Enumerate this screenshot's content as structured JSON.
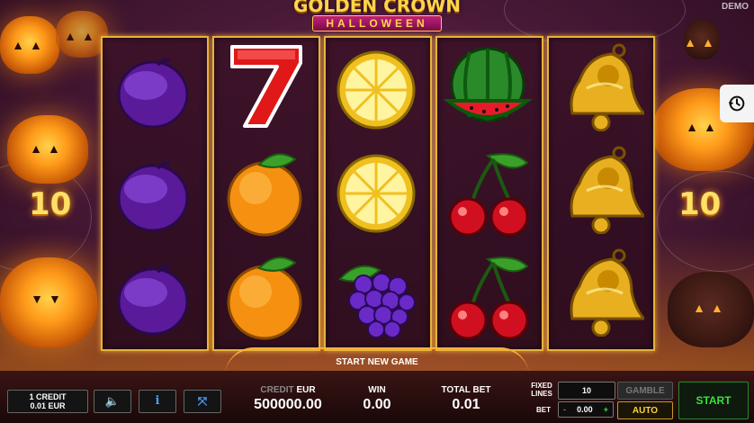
{
  "game": {
    "title": "GOLDEN CROWN",
    "subtitle": "HALLOWEEN",
    "mode_badge": "DEMO",
    "lines_left": "10",
    "lines_right": "10",
    "message": "START NEW GAME"
  },
  "reels": [
    {
      "symbols": [
        "plum",
        "plum",
        "plum"
      ]
    },
    {
      "symbols": [
        "seven",
        "orange",
        "orange"
      ]
    },
    {
      "symbols": [
        "lemon",
        "lemon",
        "grapes"
      ]
    },
    {
      "symbols": [
        "watermelon",
        "cherries",
        "cherries"
      ]
    },
    {
      "symbols": [
        "bell",
        "bell",
        "bell"
      ]
    }
  ],
  "controls": {
    "credit_value_line1": "1 CREDIT",
    "credit_value_line2": "0.01 EUR",
    "sound_icon": "speaker-icon",
    "info_icon": "info-icon",
    "fullscreen_icon": "fullscreen-icon",
    "credit_label": "CREDIT",
    "credit_currency": "EUR",
    "credit_amount": "500000.00",
    "win_label": "WIN",
    "win_amount": "0.00",
    "total_bet_label": "TOTAL BET",
    "total_bet_amount": "0.01",
    "fixed_lines_label_1": "FIXED",
    "fixed_lines_label_2": "LINES",
    "fixed_lines_value": "10",
    "bet_label": "BET",
    "bet_minus": "-",
    "bet_value": "0.00",
    "bet_plus": "+",
    "gamble_label": "GAMBLE",
    "auto_label": "AUTO",
    "start_label": "START"
  },
  "colors": {
    "reel_border": "#e8b23a",
    "start_green": "#3ae03a",
    "auto_gold": "#ffd23a",
    "icon_blue": "#4aa0ff"
  }
}
